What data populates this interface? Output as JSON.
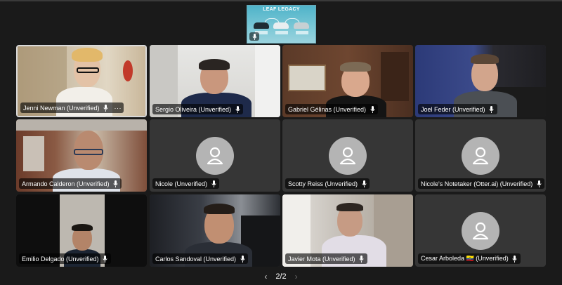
{
  "shared_content": {
    "title": "LEAF LEGACY"
  },
  "pager": {
    "label": "2/2",
    "prev": "‹",
    "next": "›"
  },
  "participants": [
    {
      "name": "Jenni Newman (Unverified)",
      "video": true,
      "active": true,
      "menu": "···"
    },
    {
      "name": "Sergio Oliveira (Unverified)",
      "video": true
    },
    {
      "name": "Gabriel Gélinas (Unverified)",
      "video": true
    },
    {
      "name": "Joel Feder (Unverified)",
      "video": true
    },
    {
      "name": "Armando Calderon (Unverified)",
      "video": true
    },
    {
      "name": "Nicole (Unverified)",
      "video": false
    },
    {
      "name": "Scotty Reiss (Unverified)",
      "video": false
    },
    {
      "name": "Nicole's Notetaker (Otter.ai) (Unverified)",
      "video": false
    },
    {
      "name": "Emilio Delgado (Unverified)",
      "video": true
    },
    {
      "name": "Carlos Sandoval (Unverified)",
      "video": true
    },
    {
      "name": "Javier Mota (Unverified)",
      "video": true
    },
    {
      "name": "Cesar Arboleda 🇪🇨 (Unverified)",
      "video": false
    }
  ],
  "icons": {
    "mic": "microphone-icon",
    "avatar": "person-avatar-icon",
    "more": "more-options-icon",
    "prev": "chevron-left-icon",
    "next": "chevron-right-icon"
  }
}
